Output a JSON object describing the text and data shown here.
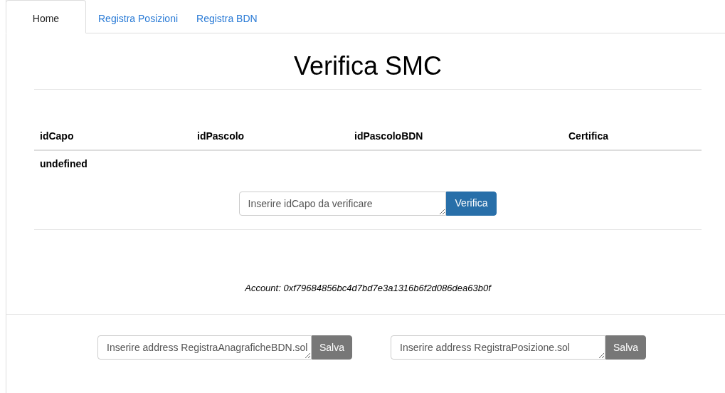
{
  "tabs": [
    {
      "label": "Home",
      "selected": true
    },
    {
      "label": "Registra Posizioni",
      "selected": false
    },
    {
      "label": "Registra BDN",
      "selected": false
    }
  ],
  "title": "Verifica SMC",
  "table": {
    "columns": [
      "idCapo",
      "idPascolo",
      "idPascoloBDN",
      "Certifica"
    ],
    "rows": [
      [
        "undefined"
      ]
    ]
  },
  "verify": {
    "placeholder": "Inserire idCapo da verificare",
    "button": "Verifica"
  },
  "account": "Account: 0xf79684856bc4d7bd7e3a1316b6f2d086dea63b0f",
  "address_forms": [
    {
      "placeholder": "Inserire address RegistraAnagraficheBDN.sol",
      "button": "Salva"
    },
    {
      "placeholder": "Inserire address RegistraPosizione.sol",
      "button": "Salva"
    }
  ]
}
